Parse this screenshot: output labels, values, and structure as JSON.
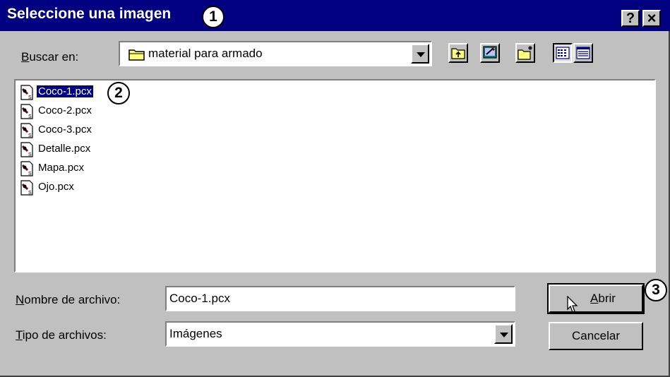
{
  "window": {
    "title": "Seleccione una imagen",
    "help_button": "?",
    "close_button": "×"
  },
  "callouts": [
    "1",
    "2",
    "3"
  ],
  "look_in": {
    "label_accel": "B",
    "label_rest": "uscar en:",
    "value": "material para armado"
  },
  "toolbar": {
    "icons": [
      "up-one-level-icon",
      "desktop-icon",
      "new-folder-icon",
      "list-view-icon",
      "details-view-icon"
    ]
  },
  "files": [
    {
      "name": "Coco-1.pcx",
      "selected": true
    },
    {
      "name": "Coco-2.pcx",
      "selected": false
    },
    {
      "name": "Coco-3.pcx",
      "selected": false
    },
    {
      "name": "Detalle.pcx",
      "selected": false
    },
    {
      "name": "Mapa.pcx",
      "selected": false
    },
    {
      "name": "Ojo.pcx",
      "selected": false
    }
  ],
  "filename": {
    "label_accel": "N",
    "label_rest": "ombre de archivo:",
    "value": "Coco-1.pcx"
  },
  "filetype": {
    "label_accel": "T",
    "label_rest": "ipo de archivos:",
    "value": "Imágenes"
  },
  "buttons": {
    "open_accel": "A",
    "open_rest": "brir",
    "cancel": "Cancelar"
  },
  "colors": {
    "titlebar": "#000080",
    "dialog": "#c0c0c0",
    "selection": "#000080"
  }
}
